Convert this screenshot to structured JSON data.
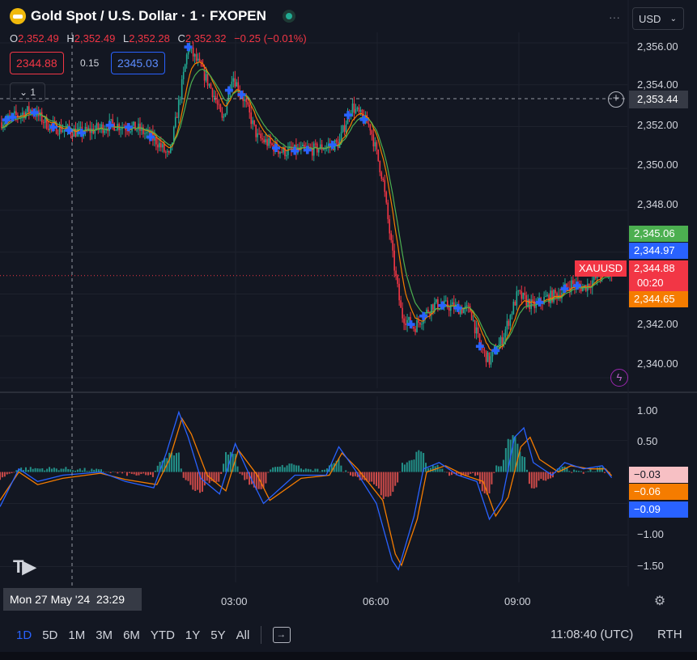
{
  "header": {
    "title": "Gold Spot / U.S. Dollar · 1 · FXOPEN",
    "ohlc": [
      {
        "label": "O",
        "value": "2,352.49"
      },
      {
        "label": "H",
        "value": "2,352.49"
      },
      {
        "label": "L",
        "value": "2,352.28"
      },
      {
        "label": "C",
        "value": "2,352.32"
      }
    ],
    "change": "−0.25 (−0.01%)",
    "bid": "2344.88",
    "spread": "0.15",
    "ask": "2345.03",
    "collapse_count": "1",
    "currency": "USD"
  },
  "crosshair": {
    "price": "2,353.44",
    "date": "Mon 27 May '24",
    "time": "23:29"
  },
  "price_labels": {
    "green": "2,345.06",
    "blue": "2,344.97",
    "symbol": "XAUUSD",
    "last": "2,344.88",
    "countdown": "00:20",
    "orange": "2,344.65"
  },
  "osc_labels": {
    "hist": "−0.03",
    "signal": "−0.06",
    "macd": "−0.09"
  },
  "colors": {
    "up": "#22ab94",
    "down": "#f23645",
    "blue": "#2962ff",
    "orange": "#f57c00",
    "green": "#4caf50",
    "bg": "#131722"
  },
  "bottom_bar": {
    "timeframes": [
      "1D",
      "5D",
      "1M",
      "3M",
      "6M",
      "YTD",
      "1Y",
      "5Y",
      "All"
    ],
    "active": "1D",
    "clock": "11:08:40 (UTC)",
    "session": "RTH"
  },
  "chart_data": [
    {
      "type": "candlestick",
      "x_ticks": [
        "03:00",
        "06:00",
        "09:00"
      ],
      "y_ticks": [
        "2,356.00",
        "2,354.00",
        "2,352.00",
        "2,350.00",
        "2,348.00",
        "2,342.00",
        "2,340.00"
      ],
      "ylim": [
        2339.5,
        2356.5
      ],
      "last_price": 2344.88,
      "path": [
        [
          0,
          2352.2
        ],
        [
          0.05,
          2352.8
        ],
        [
          0.08,
          2352.0
        ],
        [
          0.13,
          2351.7
        ],
        [
          0.18,
          2352.1
        ],
        [
          0.22,
          2351.9
        ],
        [
          0.25,
          2351.3
        ],
        [
          0.27,
          2350.5
        ],
        [
          0.29,
          2354.0
        ],
        [
          0.3,
          2355.8
        ],
        [
          0.32,
          2354.8
        ],
        [
          0.34,
          2353.6
        ],
        [
          0.355,
          2352.2
        ],
        [
          0.37,
          2354.5
        ],
        [
          0.39,
          2353.2
        ],
        [
          0.41,
          2351.5
        ],
        [
          0.45,
          2350.8
        ],
        [
          0.5,
          2350.9
        ],
        [
          0.54,
          2351.2
        ],
        [
          0.56,
          2353.0
        ],
        [
          0.59,
          2352.0
        ],
        [
          0.61,
          2349.5
        ],
        [
          0.625,
          2346.0
        ],
        [
          0.64,
          2343.0
        ],
        [
          0.66,
          2342.4
        ],
        [
          0.69,
          2343.5
        ],
        [
          0.72,
          2343.4
        ],
        [
          0.75,
          2343.2
        ],
        [
          0.765,
          2341.5
        ],
        [
          0.78,
          2340.8
        ],
        [
          0.8,
          2341.8
        ],
        [
          0.825,
          2344.0
        ],
        [
          0.85,
          2343.4
        ],
        [
          0.87,
          2343.8
        ],
        [
          0.89,
          2344.0
        ],
        [
          0.91,
          2344.5
        ],
        [
          0.93,
          2344.3
        ],
        [
          0.96,
          2345.0
        ],
        [
          0.975,
          2344.88
        ]
      ]
    },
    {
      "type": "line",
      "y_ticks": [
        "1.00",
        "0.50",
        "−1.00",
        "−1.50"
      ],
      "ylim": [
        -1.75,
        1.2
      ],
      "macd": [
        [
          0,
          -0.55
        ],
        [
          0.03,
          0.05
        ],
        [
          0.06,
          -0.15
        ],
        [
          0.1,
          -0.05
        ],
        [
          0.16,
          0.0
        ],
        [
          0.2,
          -0.15
        ],
        [
          0.245,
          -0.25
        ],
        [
          0.265,
          0.3
        ],
        [
          0.285,
          0.95
        ],
        [
          0.3,
          0.55
        ],
        [
          0.32,
          -0.1
        ],
        [
          0.35,
          -0.35
        ],
        [
          0.375,
          0.45
        ],
        [
          0.4,
          -0.1
        ],
        [
          0.42,
          -0.5
        ],
        [
          0.47,
          -0.05
        ],
        [
          0.52,
          -0.05
        ],
        [
          0.54,
          0.4
        ],
        [
          0.565,
          0.05
        ],
        [
          0.6,
          -0.5
        ],
        [
          0.625,
          -1.4
        ],
        [
          0.635,
          -1.55
        ],
        [
          0.66,
          -0.7
        ],
        [
          0.675,
          0.05
        ],
        [
          0.7,
          0.15
        ],
        [
          0.73,
          -0.05
        ],
        [
          0.76,
          -0.15
        ],
        [
          0.78,
          -0.75
        ],
        [
          0.8,
          -0.45
        ],
        [
          0.82,
          0.55
        ],
        [
          0.835,
          0.7
        ],
        [
          0.85,
          0.15
        ],
        [
          0.88,
          -0.05
        ],
        [
          0.9,
          0.15
        ],
        [
          0.93,
          0.05
        ],
        [
          0.96,
          0.1
        ],
        [
          0.975,
          -0.09
        ]
      ],
      "signal": [
        [
          0,
          -0.45
        ],
        [
          0.03,
          0.0
        ],
        [
          0.06,
          -0.2
        ],
        [
          0.1,
          -0.1
        ],
        [
          0.16,
          -0.02
        ],
        [
          0.2,
          -0.12
        ],
        [
          0.25,
          -0.2
        ],
        [
          0.27,
          0.2
        ],
        [
          0.29,
          0.85
        ],
        [
          0.305,
          0.6
        ],
        [
          0.33,
          -0.05
        ],
        [
          0.36,
          -0.3
        ],
        [
          0.38,
          0.35
        ],
        [
          0.41,
          -0.05
        ],
        [
          0.43,
          -0.45
        ],
        [
          0.48,
          -0.1
        ],
        [
          0.525,
          -0.05
        ],
        [
          0.545,
          0.3
        ],
        [
          0.57,
          0.05
        ],
        [
          0.61,
          -0.45
        ],
        [
          0.63,
          -1.3
        ],
        [
          0.64,
          -1.48
        ],
        [
          0.665,
          -0.75
        ],
        [
          0.68,
          0.0
        ],
        [
          0.71,
          0.1
        ],
        [
          0.74,
          -0.05
        ],
        [
          0.77,
          -0.15
        ],
        [
          0.79,
          -0.7
        ],
        [
          0.81,
          -0.4
        ],
        [
          0.83,
          0.4
        ],
        [
          0.845,
          0.55
        ],
        [
          0.86,
          0.2
        ],
        [
          0.89,
          0.0
        ],
        [
          0.91,
          0.1
        ],
        [
          0.94,
          0.05
        ],
        [
          0.965,
          0.05
        ],
        [
          0.975,
          -0.06
        ]
      ],
      "hist_last": -0.03
    }
  ]
}
